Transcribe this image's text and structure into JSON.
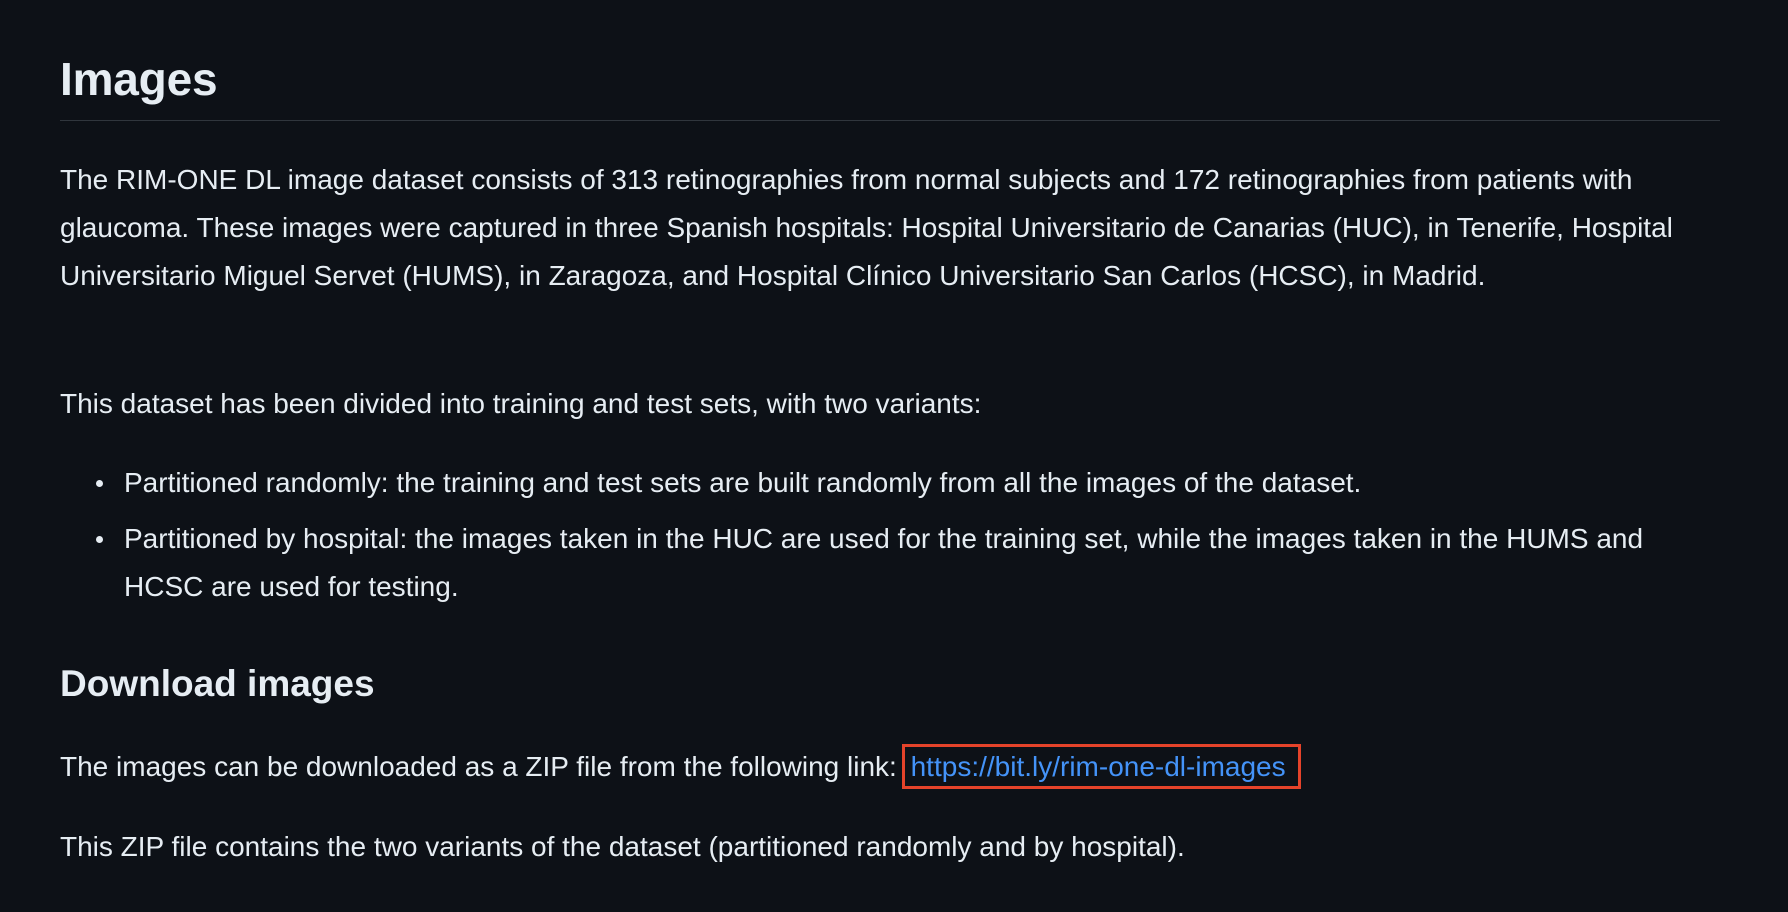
{
  "images_section": {
    "title": "Images",
    "intro": "The RIM-ONE DL image dataset consists of 313 retinographies from normal subjects and 172 retinographies from patients with glaucoma. These images were captured in three Spanish hospitals: Hospital Universitario de Canarias (HUC), in Tenerife, Hospital Universitario Miguel Servet (HUMS), in Zaragoza, and Hospital Clínico Universitario San Carlos (HCSC), in Madrid.",
    "division_text": "This dataset has been divided into training and test sets, with two variants:",
    "variants": [
      "Partitioned randomly: the training and test sets are built randomly from all the images of the dataset.",
      "Partitioned by hospital: the images taken in the HUC are used for the training set, while the images taken in the HUMS and HCSC are used for testing."
    ]
  },
  "download_section": {
    "title": "Download images",
    "link_intro": "The images can be downloaded as a ZIP file from the following link: ",
    "link_text": "https://bit.ly/rim-one-dl-images",
    "zip_note": "This ZIP file contains the two variants of the dataset (partitioned randomly and by hospital)."
  },
  "colors": {
    "background": "#0d1117",
    "text": "#e6edf3",
    "link": "#4493f8",
    "highlight_border": "#e5432a",
    "divider": "#30363d"
  }
}
